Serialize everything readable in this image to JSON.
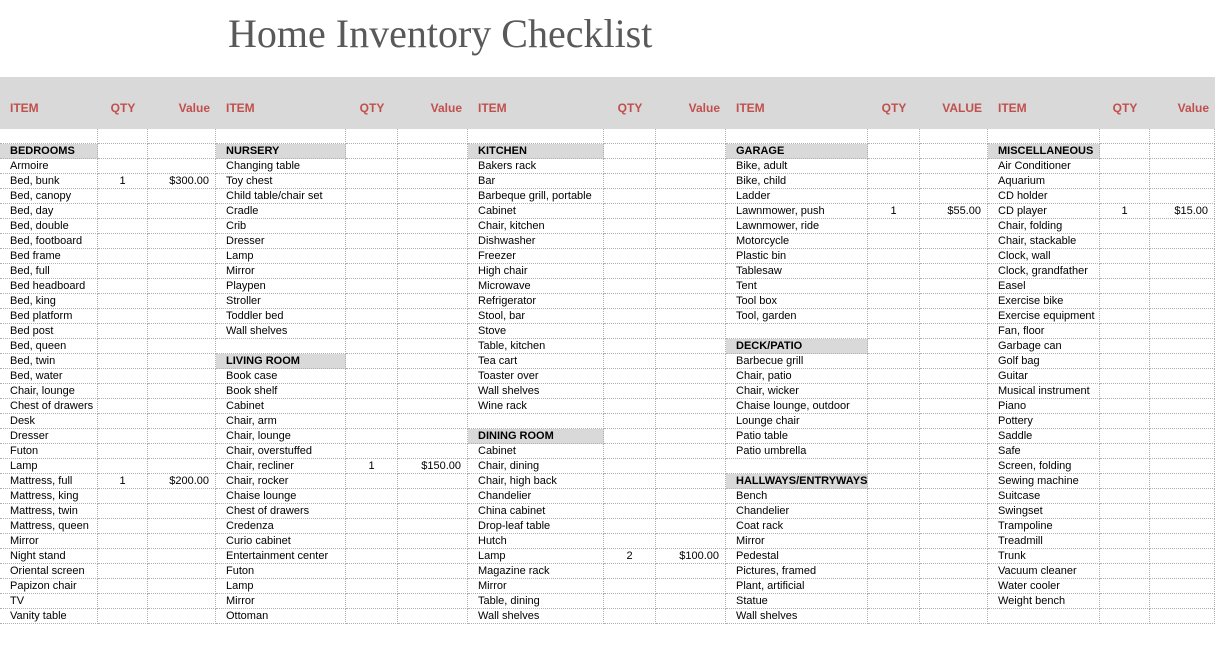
{
  "title": "Home Inventory Checklist",
  "headers": {
    "item": "ITEM",
    "qty": "QTY",
    "value": "Value",
    "value_alt": "VALUE"
  },
  "columns": [
    {
      "class": "g1",
      "val_header": "Value",
      "rows": [
        {
          "t": "blank"
        },
        {
          "t": "sect",
          "item": "BEDROOMS"
        },
        {
          "t": "d",
          "item": "Armoire"
        },
        {
          "t": "d",
          "item": "Bed, bunk",
          "qty": "1",
          "val": "$300.00"
        },
        {
          "t": "d",
          "item": "Bed, canopy"
        },
        {
          "t": "d",
          "item": "Bed, day"
        },
        {
          "t": "d",
          "item": "Bed, double"
        },
        {
          "t": "d",
          "item": "Bed, footboard"
        },
        {
          "t": "d",
          "item": "Bed frame"
        },
        {
          "t": "d",
          "item": "Bed, full"
        },
        {
          "t": "d",
          "item": "Bed headboard"
        },
        {
          "t": "d",
          "item": "Bed, king"
        },
        {
          "t": "d",
          "item": "Bed platform"
        },
        {
          "t": "d",
          "item": "Bed post"
        },
        {
          "t": "d",
          "item": "Bed, queen"
        },
        {
          "t": "d",
          "item": "Bed, twin"
        },
        {
          "t": "d",
          "item": "Bed, water"
        },
        {
          "t": "d",
          "item": "Chair, lounge"
        },
        {
          "t": "d",
          "item": "Chest of drawers"
        },
        {
          "t": "d",
          "item": "Desk"
        },
        {
          "t": "d",
          "item": "Dresser"
        },
        {
          "t": "d",
          "item": "Futon"
        },
        {
          "t": "d",
          "item": "Lamp"
        },
        {
          "t": "d",
          "item": "Mattress, full",
          "qty": "1",
          "val": "$200.00"
        },
        {
          "t": "d",
          "item": "Mattress, king"
        },
        {
          "t": "d",
          "item": "Mattress, twin"
        },
        {
          "t": "d",
          "item": "Mattress, queen"
        },
        {
          "t": "d",
          "item": "Mirror"
        },
        {
          "t": "d",
          "item": "Night stand"
        },
        {
          "t": "d",
          "item": "Oriental screen"
        },
        {
          "t": "d",
          "item": "Papizon chair"
        },
        {
          "t": "d",
          "item": "TV"
        },
        {
          "t": "d",
          "item": "Vanity table"
        }
      ]
    },
    {
      "class": "g2",
      "val_header": "Value",
      "rows": [
        {
          "t": "blank"
        },
        {
          "t": "sect",
          "item": "NURSERY"
        },
        {
          "t": "d",
          "item": "Changing table"
        },
        {
          "t": "d",
          "item": "Toy chest"
        },
        {
          "t": "d",
          "item": "Child table/chair set"
        },
        {
          "t": "d",
          "item": "Cradle"
        },
        {
          "t": "d",
          "item": "Crib"
        },
        {
          "t": "d",
          "item": "Dresser"
        },
        {
          "t": "d",
          "item": "Lamp"
        },
        {
          "t": "d",
          "item": "Mirror"
        },
        {
          "t": "d",
          "item": "Playpen"
        },
        {
          "t": "d",
          "item": "Stroller"
        },
        {
          "t": "d",
          "item": "Toddler bed"
        },
        {
          "t": "d",
          "item": "Wall shelves"
        },
        {
          "t": "blank"
        },
        {
          "t": "sect",
          "item": "LIVING ROOM"
        },
        {
          "t": "d",
          "item": "Book case"
        },
        {
          "t": "d",
          "item": "Book shelf"
        },
        {
          "t": "d",
          "item": "Cabinet"
        },
        {
          "t": "d",
          "item": "Chair, arm"
        },
        {
          "t": "d",
          "item": "Chair, lounge"
        },
        {
          "t": "d",
          "item": "Chair, overstuffed"
        },
        {
          "t": "d",
          "item": "Chair, recliner",
          "qty": "1",
          "val": "$150.00"
        },
        {
          "t": "d",
          "item": "Chair, rocker"
        },
        {
          "t": "d",
          "item": "Chaise lounge"
        },
        {
          "t": "d",
          "item": "Chest of drawers"
        },
        {
          "t": "d",
          "item": "Credenza"
        },
        {
          "t": "d",
          "item": "Curio cabinet"
        },
        {
          "t": "d",
          "item": "Entertainment center"
        },
        {
          "t": "d",
          "item": "Futon"
        },
        {
          "t": "d",
          "item": "Lamp"
        },
        {
          "t": "d",
          "item": "Mirror"
        },
        {
          "t": "d",
          "item": "Ottoman"
        }
      ]
    },
    {
      "class": "g3",
      "val_header": "Value",
      "rows": [
        {
          "t": "blank"
        },
        {
          "t": "sect",
          "item": "KITCHEN"
        },
        {
          "t": "d",
          "item": "Bakers rack"
        },
        {
          "t": "d",
          "item": "Bar"
        },
        {
          "t": "d",
          "item": "Barbeque grill, portable"
        },
        {
          "t": "d",
          "item": "Cabinet"
        },
        {
          "t": "d",
          "item": "Chair, kitchen"
        },
        {
          "t": "d",
          "item": "Dishwasher"
        },
        {
          "t": "d",
          "item": "Freezer"
        },
        {
          "t": "d",
          "item": "High chair"
        },
        {
          "t": "d",
          "item": "Microwave"
        },
        {
          "t": "d",
          "item": "Refrigerator"
        },
        {
          "t": "d",
          "item": "Stool, bar"
        },
        {
          "t": "d",
          "item": "Stove"
        },
        {
          "t": "d",
          "item": "Table, kitchen"
        },
        {
          "t": "d",
          "item": "Tea cart"
        },
        {
          "t": "d",
          "item": "Toaster over"
        },
        {
          "t": "d",
          "item": "Wall shelves"
        },
        {
          "t": "d",
          "item": "Wine rack"
        },
        {
          "t": "blank"
        },
        {
          "t": "sect",
          "item": "DINING ROOM"
        },
        {
          "t": "d",
          "item": "Cabinet"
        },
        {
          "t": "d",
          "item": "Chair, dining"
        },
        {
          "t": "d",
          "item": "Chair, high back"
        },
        {
          "t": "d",
          "item": "Chandelier"
        },
        {
          "t": "d",
          "item": "China cabinet"
        },
        {
          "t": "d",
          "item": "Drop-leaf table"
        },
        {
          "t": "d",
          "item": "Hutch"
        },
        {
          "t": "d",
          "item": "Lamp",
          "qty": "2",
          "val": "$100.00"
        },
        {
          "t": "d",
          "item": "Magazine rack"
        },
        {
          "t": "d",
          "item": "Mirror"
        },
        {
          "t": "d",
          "item": "Table, dining"
        },
        {
          "t": "d",
          "item": "Wall shelves"
        }
      ]
    },
    {
      "class": "g4",
      "val_header": "VALUE",
      "rows": [
        {
          "t": "blank"
        },
        {
          "t": "sect",
          "item": "GARAGE"
        },
        {
          "t": "d",
          "item": "Bike, adult"
        },
        {
          "t": "d",
          "item": "Bike, child"
        },
        {
          "t": "d",
          "item": "Ladder"
        },
        {
          "t": "d",
          "item": "Lawnmower, push",
          "qty": "1",
          "val": "$55.00"
        },
        {
          "t": "d",
          "item": "Lawnmower, ride"
        },
        {
          "t": "d",
          "item": "Motorcycle"
        },
        {
          "t": "d",
          "item": "Plastic bin"
        },
        {
          "t": "d",
          "item": "Tablesaw"
        },
        {
          "t": "d",
          "item": "Tent"
        },
        {
          "t": "d",
          "item": "Tool box"
        },
        {
          "t": "d",
          "item": "Tool, garden"
        },
        {
          "t": "blank"
        },
        {
          "t": "sect",
          "item": "DECK/PATIO"
        },
        {
          "t": "d",
          "item": "Barbecue grill"
        },
        {
          "t": "d",
          "item": "Chair, patio"
        },
        {
          "t": "d",
          "item": "Chair, wicker"
        },
        {
          "t": "d",
          "item": "Chaise lounge, outdoor"
        },
        {
          "t": "d",
          "item": "Lounge chair"
        },
        {
          "t": "d",
          "item": "Patio table"
        },
        {
          "t": "d",
          "item": "Patio umbrella"
        },
        {
          "t": "blank"
        },
        {
          "t": "sect",
          "item": "HALLWAYS/ENTRYWAYS"
        },
        {
          "t": "d",
          "item": "Bench"
        },
        {
          "t": "d",
          "item": "Chandelier"
        },
        {
          "t": "d",
          "item": "Coat rack"
        },
        {
          "t": "d",
          "item": "Mirror"
        },
        {
          "t": "d",
          "item": "Pedestal"
        },
        {
          "t": "d",
          "item": "Pictures, framed"
        },
        {
          "t": "d",
          "item": "Plant, artificial"
        },
        {
          "t": "d",
          "item": "Statue"
        },
        {
          "t": "d",
          "item": "Wall shelves"
        }
      ]
    },
    {
      "class": "g5",
      "val_header": "Value",
      "rows": [
        {
          "t": "blank"
        },
        {
          "t": "sect",
          "item": "MISCELLANEOUS"
        },
        {
          "t": "d",
          "item": "Air Conditioner"
        },
        {
          "t": "d",
          "item": "Aquarium"
        },
        {
          "t": "d",
          "item": "CD holder"
        },
        {
          "t": "d",
          "item": "CD player",
          "qty": "1",
          "val": "$15.00"
        },
        {
          "t": "d",
          "item": "Chair, folding"
        },
        {
          "t": "d",
          "item": "Chair, stackable"
        },
        {
          "t": "d",
          "item": "Clock, wall"
        },
        {
          "t": "d",
          "item": "Clock, grandfather"
        },
        {
          "t": "d",
          "item": "Easel"
        },
        {
          "t": "d",
          "item": "Exercise bike"
        },
        {
          "t": "d",
          "item": "Exercise equipment"
        },
        {
          "t": "d",
          "item": "Fan, floor"
        },
        {
          "t": "d",
          "item": "Garbage can"
        },
        {
          "t": "d",
          "item": "Golf bag"
        },
        {
          "t": "d",
          "item": "Guitar"
        },
        {
          "t": "d",
          "item": "Musical instrument"
        },
        {
          "t": "d",
          "item": "Piano"
        },
        {
          "t": "d",
          "item": "Pottery"
        },
        {
          "t": "d",
          "item": "Saddle"
        },
        {
          "t": "d",
          "item": "Safe"
        },
        {
          "t": "d",
          "item": "Screen, folding"
        },
        {
          "t": "d",
          "item": "Sewing machine"
        },
        {
          "t": "d",
          "item": "Suitcase"
        },
        {
          "t": "d",
          "item": "Swingset"
        },
        {
          "t": "d",
          "item": "Trampoline"
        },
        {
          "t": "d",
          "item": "Treadmill"
        },
        {
          "t": "d",
          "item": "Trunk"
        },
        {
          "t": "d",
          "item": "Vacuum cleaner"
        },
        {
          "t": "d",
          "item": "Water cooler"
        },
        {
          "t": "d",
          "item": "Weight bench"
        },
        {
          "t": "blank"
        }
      ]
    }
  ]
}
